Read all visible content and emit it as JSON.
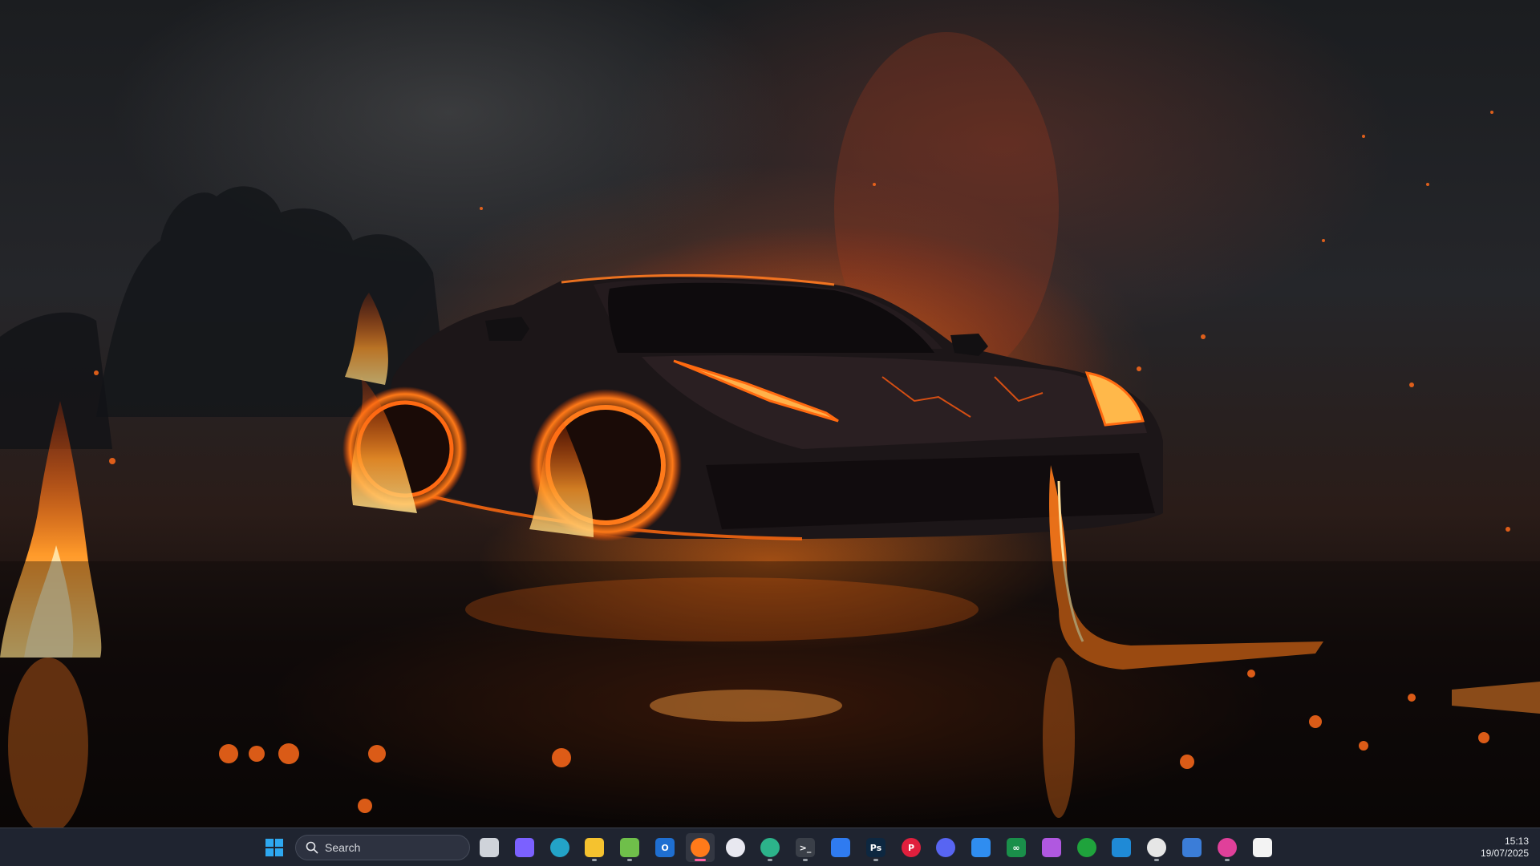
{
  "taskbar": {
    "search_label": "Search",
    "clock_time": "15:13",
    "clock_date": "19/07/2025",
    "apps": [
      {
        "name": "start-button",
        "icon": "windows-logo-icon",
        "label": "",
        "color": "#2ea8f0",
        "running": false
      },
      {
        "name": "task-view-button",
        "icon": "task-view-icon",
        "label": "",
        "color": "#cfd3da",
        "running": false
      },
      {
        "name": "copilot-button",
        "icon": "copilot-icon",
        "label": "",
        "color": "#7b61ff",
        "running": false
      },
      {
        "name": "edge-button",
        "icon": "edge-icon",
        "label": "",
        "color": "#23a3c7",
        "running": false
      },
      {
        "name": "file-explorer-button",
        "icon": "folder-icon",
        "label": "",
        "color": "#f5c22f",
        "running": true
      },
      {
        "name": "notepad-button",
        "icon": "notepad-icon",
        "label": "",
        "color": "#6fbf4a",
        "running": true
      },
      {
        "name": "outlook-button",
        "icon": "outlook-icon",
        "label": "O",
        "color": "#1f6fd1",
        "running": false
      },
      {
        "name": "firefox-button",
        "icon": "firefox-icon",
        "label": "",
        "color": "#ff7a1a",
        "running": true,
        "active": true
      },
      {
        "name": "app-dark-button",
        "icon": "moon-app-icon",
        "label": "",
        "color": "#e8e8f0",
        "running": false
      },
      {
        "name": "edge-dev-button",
        "icon": "edge-dev-icon",
        "label": "",
        "color": "#2cb38a",
        "running": true
      },
      {
        "name": "terminal-button",
        "icon": "terminal-icon",
        "label": ">_",
        "color": "#3a3f48",
        "running": true
      },
      {
        "name": "todo-button",
        "icon": "checkmark-icon",
        "label": "",
        "color": "#2f7bf0",
        "running": false
      },
      {
        "name": "photoshop-button",
        "icon": "photoshop-icon",
        "label": "Ps",
        "color": "#0d2740",
        "running": true
      },
      {
        "name": "pinterest-button",
        "icon": "pinterest-icon",
        "label": "P",
        "color": "#e01f3d",
        "running": false
      },
      {
        "name": "discord-button",
        "icon": "discord-icon",
        "label": "",
        "color": "#5865f2",
        "running": false
      },
      {
        "name": "app-window-button",
        "icon": "window-app-icon",
        "label": "",
        "color": "#2f8df0",
        "running": false
      },
      {
        "name": "infinity-app-button",
        "icon": "infinity-icon",
        "label": "∞",
        "color": "#1a8f4a",
        "running": false
      },
      {
        "name": "rocket-app-button",
        "icon": "rocket-icon",
        "label": "",
        "color": "#b058e0",
        "running": false
      },
      {
        "name": "xbox-button",
        "icon": "xbox-icon",
        "label": "",
        "color": "#1fa33c",
        "running": false
      },
      {
        "name": "vscode-button",
        "icon": "vscode-icon",
        "label": "",
        "color": "#1f8ad6",
        "running": false
      },
      {
        "name": "chatgpt-button",
        "icon": "chatgpt-icon",
        "label": "",
        "color": "#e6e6e6",
        "running": true
      },
      {
        "name": "remote-desktop-button",
        "icon": "remote-desktop-icon",
        "label": "",
        "color": "#3b7dd8",
        "running": false
      },
      {
        "name": "pink-app-button",
        "icon": "pink-app-icon",
        "label": "",
        "color": "#e0409a",
        "running": true
      },
      {
        "name": "store-button",
        "icon": "store-icon",
        "label": "",
        "color": "#f3f3f3",
        "running": false
      }
    ]
  }
}
